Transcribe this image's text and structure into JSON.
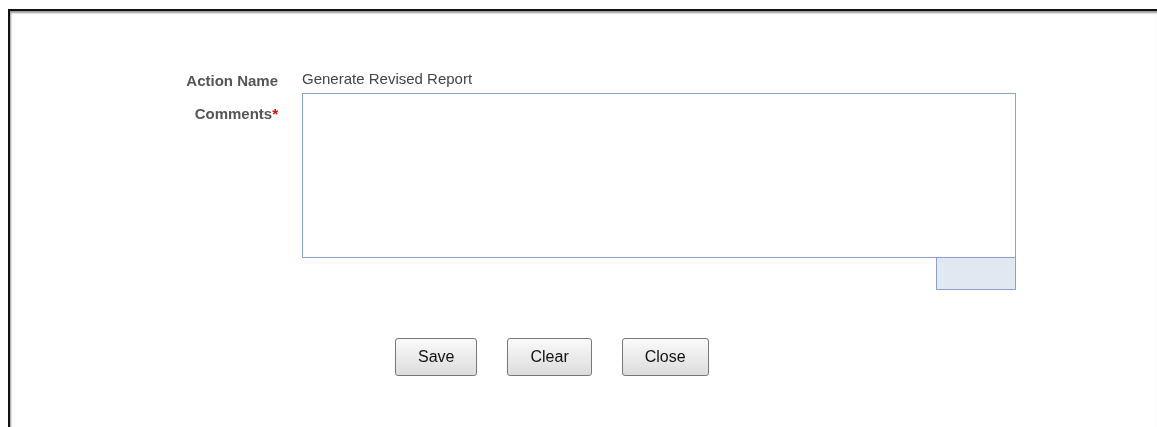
{
  "form": {
    "fields": [
      {
        "kind": "text",
        "label": "Action Name",
        "value": "Generate Revised Report"
      },
      {
        "kind": "textarea",
        "label": "Comments",
        "required_mark": "*"
      }
    ]
  },
  "buttons": [
    "Save",
    "Clear",
    "Close"
  ]
}
